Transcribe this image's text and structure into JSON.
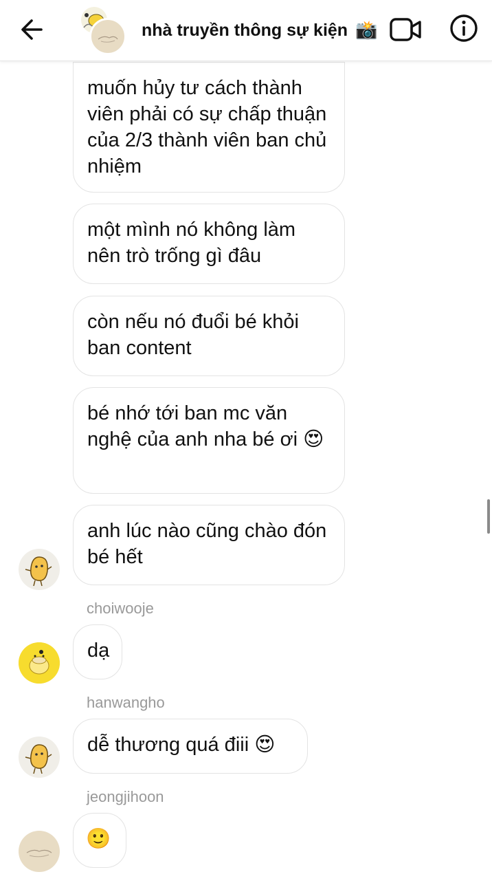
{
  "header": {
    "title": "nhà truyền thông sự kiện",
    "title_emoji": "📸",
    "icons": {
      "back": "back-arrow-icon",
      "video": "video-call-icon",
      "info": "info-icon"
    }
  },
  "messages": [
    {
      "text": "muốn hủy tư cách thành viên phải có sự chấp thuận của 2/3 thành viên ban chủ nhiệm"
    },
    {
      "text": "một mình nó không làm nên trò trống gì đâu"
    },
    {
      "text": "còn nếu nó đuổi bé khỏi ban content"
    },
    {
      "text": "bé nhớ tới ban mc văn nghệ của anh nha bé ơi",
      "emoji": "😍"
    },
    {
      "text": "anh lúc nào cũng chào đón bé hết"
    },
    {
      "sender": "choiwooje",
      "text": "dạ"
    },
    {
      "sender": "hanwangho",
      "text": "dễ thương quá điii",
      "emoji": "😍"
    },
    {
      "sender": "jeongjihoon",
      "emoji": "🙂"
    }
  ],
  "avatars": [
    "potato-avatar",
    "psyduck-avatar",
    "potato-avatar",
    "cream-avatar"
  ]
}
